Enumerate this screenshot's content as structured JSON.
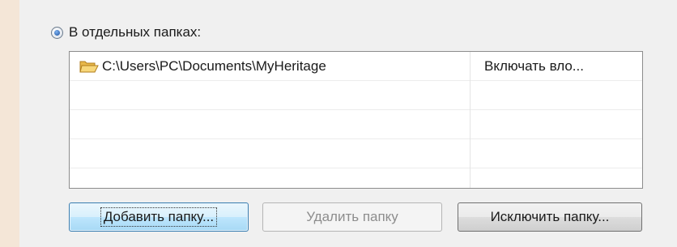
{
  "options": {
    "separate_folders_label": "В отдельных папках:",
    "separate_folders_selected": true
  },
  "folder_list": {
    "rows": [
      {
        "path": "C:\\Users\\PC\\Documents\\MyHeritage",
        "option": "Включать вло...",
        "icon": "folder-open-icon"
      },
      {
        "path": "",
        "option": ""
      },
      {
        "path": "",
        "option": ""
      },
      {
        "path": "",
        "option": ""
      },
      {
        "path": "",
        "option": ""
      }
    ]
  },
  "buttons": {
    "add_folder": "Добавить папку...",
    "remove_folder": "Удалить папку",
    "exclude_folder": "Исключить папку..."
  },
  "colors": {
    "background": "#f0f0f0",
    "list_background": "#ffffff",
    "primary_button_border": "#3c7fb1",
    "disabled_text": "#8d8d8d"
  }
}
